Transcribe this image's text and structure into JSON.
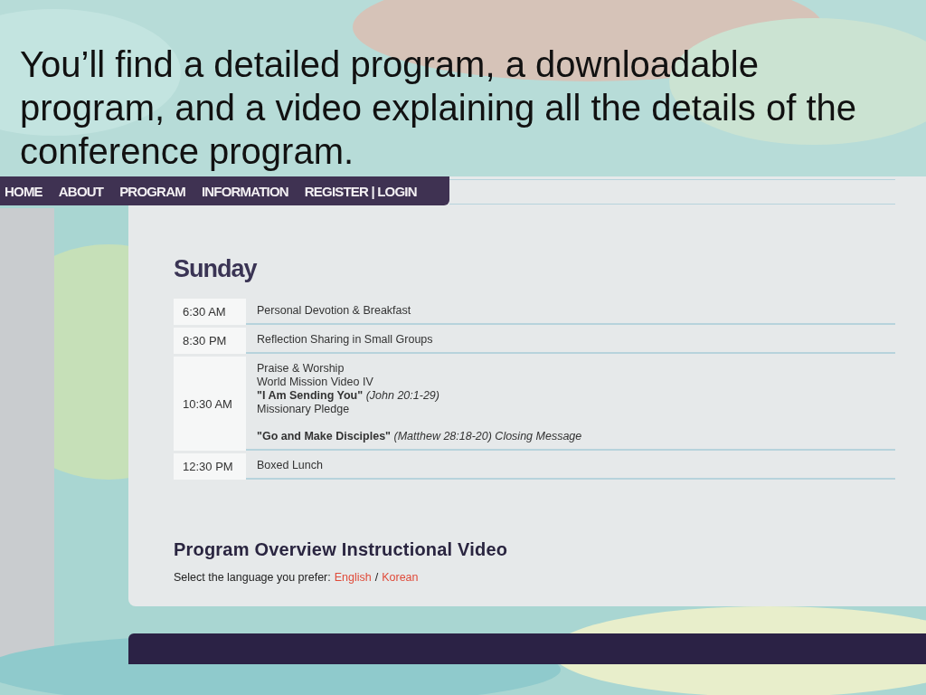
{
  "slide_text": "You’ll find a detailed program, a downloadable program, and a video explaining all the details of the conference program.",
  "nav": [
    {
      "label": "HOME"
    },
    {
      "label": "ABOUT"
    },
    {
      "label": "PROGRAM"
    },
    {
      "label": "INFORMATION"
    },
    {
      "label": "REGISTER | LOGIN"
    }
  ],
  "day_heading": "Sunday",
  "schedule": [
    {
      "time": "6:30 AM",
      "paragraphs": [
        [
          "Personal Devotion & Breakfast"
        ]
      ]
    },
    {
      "time": "8:30 PM",
      "paragraphs": [
        [
          "Reflection Sharing in Small Groups"
        ]
      ]
    },
    {
      "time": "10:30 AM",
      "paragraphs": [
        [
          "Praise & Worship",
          "World Mission Video IV",
          "**\"I Am Sending You\"** *(John 20:1-29)*",
          "Missionary Pledge"
        ],
        [
          "**\"Go and Make Disciples\"** *(Matthew 28:18-20) Closing Message*"
        ]
      ]
    },
    {
      "time": "12:30 PM",
      "paragraphs": [
        [
          "Boxed Lunch"
        ]
      ]
    }
  ],
  "video_heading": "Program Overview Instructional Video",
  "language_prompt": "Select the language you prefer:",
  "language_links": [
    {
      "label": "English"
    },
    {
      "label": "Korean"
    }
  ],
  "language_separator": "/"
}
